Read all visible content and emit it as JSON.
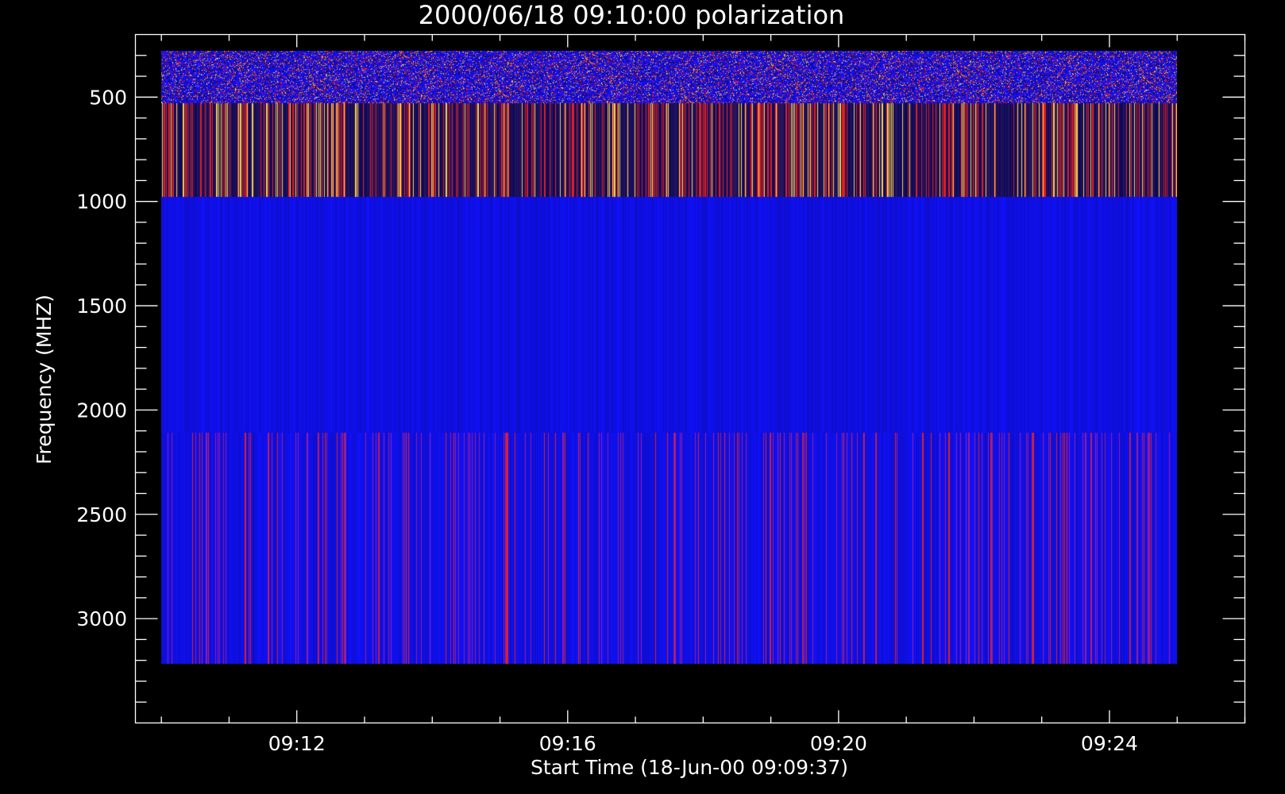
{
  "chart_data": {
    "type": "heatmap",
    "title": "2000/06/18 09:10:00 polarization",
    "xlabel": "Start Time (18-Jun-00 09:09:37)",
    "ylabel": "Frequency (MHZ)",
    "x_range": [
      "09:09:37",
      "09:26:00"
    ],
    "x_data_range": [
      "09:10:00",
      "09:25:00"
    ],
    "x_ticks": [
      "09:12",
      "09:16",
      "09:20",
      "09:24"
    ],
    "y_range": [
      200,
      3500
    ],
    "y_data_range": [
      200,
      3215
    ],
    "y_ticks": [
      500,
      1000,
      1500,
      2000,
      2500,
      3000
    ],
    "y_inverted": true,
    "colors": {
      "background": "#000000",
      "foreground": "#ffffff",
      "base": "#1010ff",
      "low": "#0a0a5a",
      "mid": "#e02020",
      "high": "#ffd24a"
    },
    "bands": [
      {
        "from_mhz": 200,
        "to_mhz": 530,
        "pattern": "speckled"
      },
      {
        "from_mhz": 530,
        "to_mhz": 980,
        "pattern": "striped-bright"
      },
      {
        "from_mhz": 980,
        "to_mhz": 2110,
        "pattern": "uniform-blue"
      },
      {
        "from_mhz": 2110,
        "to_mhz": 3215,
        "pattern": "striped-dim"
      }
    ]
  }
}
